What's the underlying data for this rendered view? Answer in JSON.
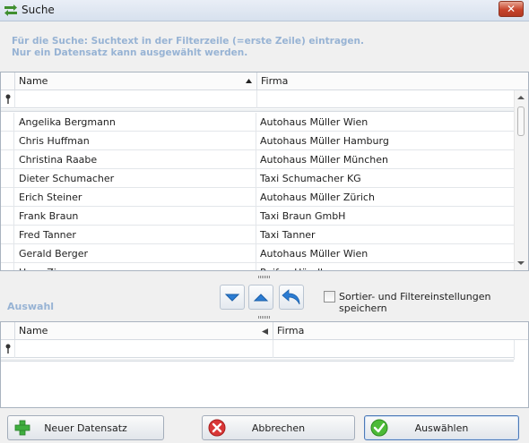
{
  "window": {
    "title": "Suche",
    "close_symbol": "✕"
  },
  "info": {
    "line1": "Für die Suche: Suchtext in der Filterzeile (=erste Zeile) eintragen.",
    "line2": "Nur ein Datensatz kann ausgewählt werden."
  },
  "main_grid": {
    "columns": [
      "Name",
      "Firma"
    ],
    "sort_column": "Name",
    "rows": [
      {
        "name": "Angelika Bergmann",
        "firma": "Autohaus Müller Wien"
      },
      {
        "name": "Chris Huffman",
        "firma": "Autohaus Müller Hamburg"
      },
      {
        "name": "Christina Raabe",
        "firma": "Autohaus Müller München"
      },
      {
        "name": "Dieter Schumacher",
        "firma": "Taxi Schumacher KG"
      },
      {
        "name": "Erich Steiner",
        "firma": "Autohaus Müller Zürich"
      },
      {
        "name": "Frank Braun",
        "firma": "Taxi Braun GmbH"
      },
      {
        "name": "Fred Tanner",
        "firma": "Taxi Tanner"
      },
      {
        "name": "Gerald Berger",
        "firma": "Autohaus Müller Wien"
      },
      {
        "name": "Hans Zimmer",
        "firma": "Reifen Händler"
      }
    ]
  },
  "middle": {
    "checkbox_label": "Sortier- und Filtereinstellungen speichern",
    "checkbox_checked": false,
    "move_down_icon": "arrow-down-icon",
    "move_up_icon": "arrow-up-icon",
    "undo_icon": "undo-icon"
  },
  "selection": {
    "title": "Auswahl",
    "columns": [
      "Name",
      "Firma"
    ]
  },
  "buttons": {
    "new": "Neuer Datensatz",
    "cancel": "Abbrechen",
    "select": "Auswählen"
  },
  "colors": {
    "info_text": "#97b3d4",
    "accent": "#1f6fc5"
  }
}
